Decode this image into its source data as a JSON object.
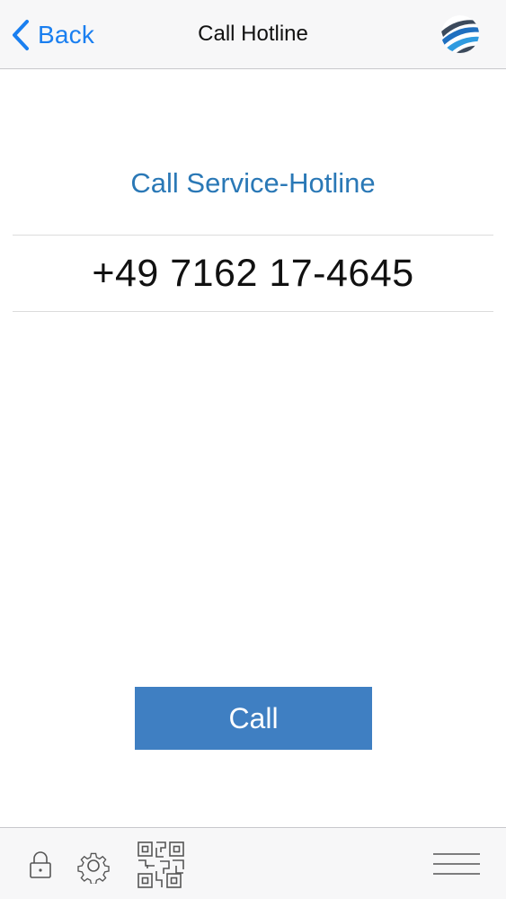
{
  "header": {
    "back_label": "Back",
    "title": "Call Hotline",
    "logo_icon": "globe-swoosh-logo"
  },
  "content": {
    "heading": "Call Service-Hotline",
    "phone_number": "+49 7162 17-4645",
    "call_button_label": "Call"
  },
  "toolbar": {
    "icons": [
      "lock-icon",
      "gear-icon",
      "qr-code-icon",
      "menu-icon"
    ]
  },
  "colors": {
    "accent": "#1a7ff0",
    "heading": "#2a78b6",
    "button": "#3f7fc2",
    "bar_background": "#f7f7f8"
  }
}
